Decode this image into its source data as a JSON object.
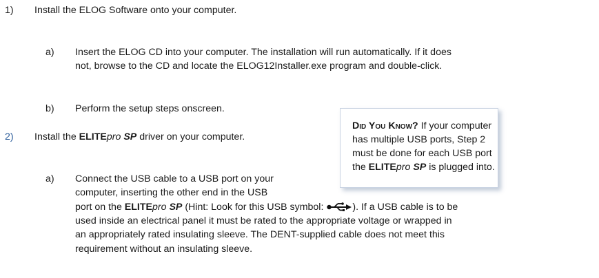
{
  "steps": [
    {
      "number": "1)",
      "text": "Install the ELOG Software onto your computer.",
      "substeps": [
        {
          "letter": "a)",
          "lines": [
            "Insert the ELOG CD into your computer. The installation will run automatically. If it does",
            "not, browse to the CD and locate the ELOG12Installer.exe program and double-click."
          ]
        },
        {
          "letter": "b)",
          "lines": [
            "Perform the setup steps onscreen."
          ]
        }
      ]
    },
    {
      "number": "2)",
      "text_pre": "Install the ",
      "brand_bold": "ELITE",
      "brand_italic": "pro",
      "brand_space": " ",
      "brand_bold_italic": "SP",
      "text_post": " driver on your computer.",
      "substeps": [
        {
          "letter": "a)",
          "line1": "Connect the USB cable to a USB port on your",
          "line2": "computer, inserting the other end in the USB",
          "line3_pre": "port on the ",
          "line3_mid": " (Hint: Look for this USB symbol: ",
          "line3_post": "). If a USB cable is to be",
          "line4": "used inside an electrical panel it must be rated to the appropriate voltage or wrapped in",
          "line5": "an appropriately rated insulating sleeve. The DENT-supplied cable does not meet this",
          "line6": "requirement without an insulating sleeve.",
          "icon": "usb-symbol-icon"
        }
      ]
    }
  ],
  "callout": {
    "heading": "Did You Know?",
    "line1_rest": " If your computer",
    "line2": "has multiple USB ports, Step 2",
    "line3": "must be done for each USB port",
    "line4_pre": "the ",
    "line4_post": " is plugged into."
  },
  "colors": {
    "step2_number": "#2b5c9a",
    "callout_shadow": "#7e8fb0"
  }
}
